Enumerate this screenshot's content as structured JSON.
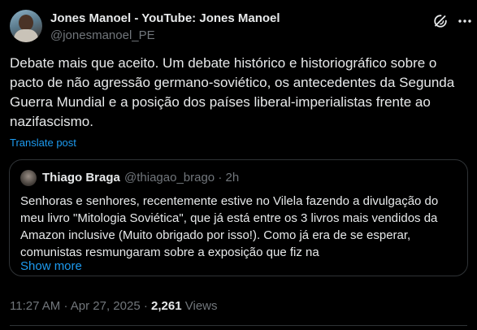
{
  "colors": {
    "background": "#000000",
    "text": "#e7e9ea",
    "muted": "#71767b",
    "link": "#1d9bf0",
    "border": "#2f3336"
  },
  "author": {
    "name": "Jones Manoel - YouTube: Jones Manoel",
    "handle": "@jonesmanoel_PE",
    "avatar_icon": "avatar"
  },
  "header_icons": {
    "grok": "grok-icon",
    "more": "more-options-icon"
  },
  "tweet": {
    "text": "Debate mais que aceito. Um debate histórico e historiográfico sobre o pacto de não agressão germano-soviético, os antecedentes da Segunda Guerra Mundial e a posição dos países liberal-imperialistas frente ao nazifascismo.",
    "translate_label": "Translate post"
  },
  "quote": {
    "name": "Thiago Braga",
    "handle": "@thiagao_brago",
    "separator": "·",
    "time": "2h",
    "text": "Senhoras e senhores, recentemente estive no Vilela fazendo a divulgação do meu livro \"Mitologia Soviética\", que já está entre os 3 livros mais vendidos da Amazon inclusive (Muito obrigado por isso!). Como já era de se esperar, comunistas resmungaram sobre a exposição que fiz na",
    "show_more": "Show more"
  },
  "meta": {
    "time": "11:27 AM",
    "separator": "·",
    "date": "Apr 27, 2025",
    "views_count": "2,261",
    "views_label": "Views"
  }
}
